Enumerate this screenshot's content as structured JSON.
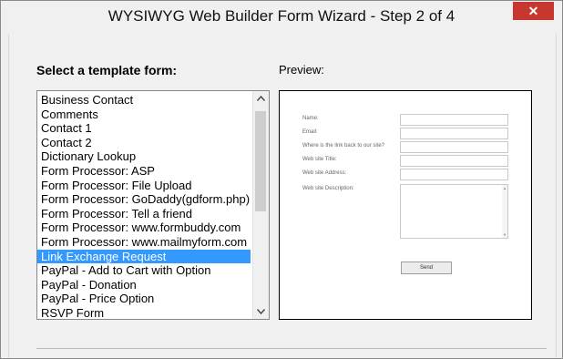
{
  "window": {
    "title": "WYSIWYG Web Builder Form Wizard - Step 2 of 4",
    "close_label": "✕"
  },
  "templates": {
    "heading": "Select a template form:",
    "items": [
      "Business Contact",
      "Comments",
      "Contact 1",
      "Contact 2",
      "Dictionary Lookup",
      "Form Processor: ASP",
      "Form Processor: File Upload",
      "Form Processor: GoDaddy(gdform.php)",
      "Form Processor: Tell a friend",
      "Form Processor: www.formbuddy.com",
      "Form Processor: www.mailmyform.com",
      "Link Exchange Request",
      "PayPal - Add to Cart with Option",
      "PayPal - Donation",
      "PayPal - Price Option",
      "RSVP Form"
    ],
    "selected_index": 11,
    "scroll_up_icon": "chevron-up-icon",
    "scroll_down_icon": "chevron-down-icon"
  },
  "preview": {
    "label": "Preview:",
    "fields": [
      "Name:",
      "Email:",
      "Where is the link back to our site?",
      "Web site Title:",
      "Web site Address:",
      "Web site Description:"
    ],
    "send_label": "Send"
  },
  "colors": {
    "selection": "#3399ff",
    "close_button": "#c7372f"
  }
}
